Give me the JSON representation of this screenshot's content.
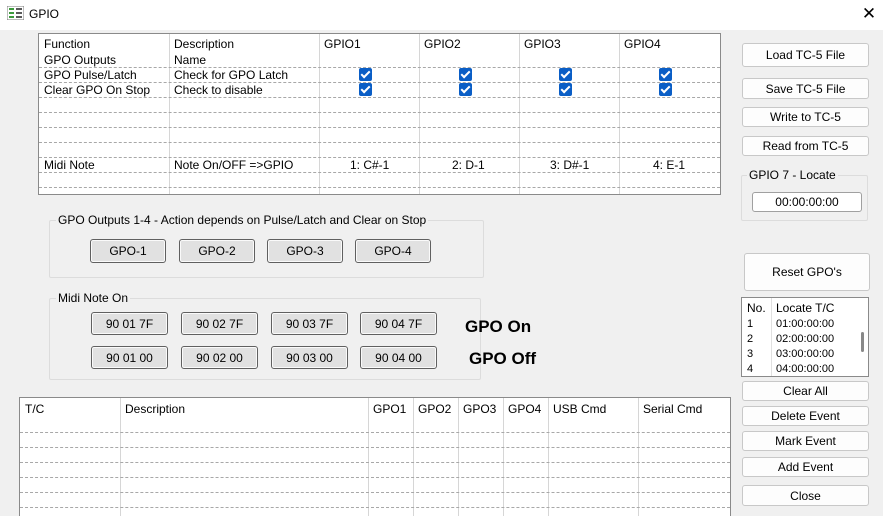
{
  "window": {
    "title": "GPIO",
    "close_glyph": "✕",
    "icon": "gpio-app-icon"
  },
  "gpio_grid": {
    "headers": [
      "Function",
      "Description",
      "GPIO1",
      "GPIO2",
      "GPIO3",
      "GPIO4"
    ],
    "rows": [
      {
        "function": "GPO Outputs",
        "description": "Name",
        "checks": [
          false,
          false,
          false,
          false
        ]
      },
      {
        "function": "GPO Pulse/Latch",
        "description": "Check for GPO Latch",
        "checks": [
          true,
          true,
          true,
          true
        ]
      },
      {
        "function": "Clear GPO On Stop",
        "description": "Check to disable",
        "checks": [
          true,
          true,
          true,
          true
        ]
      }
    ],
    "midi_row": {
      "function": "Midi Note",
      "description": "Note On/OFF =>GPIO",
      "notes": [
        "1: C#-1",
        "2: D-1",
        "3: D#-1",
        "4: E-1"
      ]
    }
  },
  "gpo_outputs_group": {
    "label": "GPO Outputs 1-4 - Action depends on Pulse/Latch and Clear on Stop",
    "buttons": [
      "GPO-1",
      "GPO-2",
      "GPO-3",
      "GPO-4"
    ]
  },
  "midi_group": {
    "label": "Midi Note On",
    "on_buttons": [
      "90 01 7F",
      "90 02 7F",
      "90 03 7F",
      "90 04 7F"
    ],
    "off_buttons": [
      "90 01 00",
      "90 02 00",
      "90 03 00",
      "90 04 00"
    ],
    "on_label": "GPO On",
    "off_label": "GPO Off"
  },
  "event_grid": {
    "headers": [
      "T/C",
      "Description",
      "GPO1",
      "GPO2",
      "GPO3",
      "GPO4",
      "USB Cmd",
      "Serial Cmd"
    ]
  },
  "right_panel": {
    "load": "Load TC-5 File",
    "save": "Save TC-5 File",
    "write": "Write to TC-5",
    "read": "Read from TC-5",
    "locate_group_label": "GPIO 7 - Locate",
    "locate_value": "00:00:00:00",
    "reset": "Reset GPO's",
    "locate_list": {
      "headers": [
        "No.",
        "Locate T/C"
      ],
      "rows": [
        {
          "no": "1",
          "tc": "01:00:00:00"
        },
        {
          "no": "2",
          "tc": "02:00:00:00"
        },
        {
          "no": "3",
          "tc": "03:00:00:00"
        },
        {
          "no": "4",
          "tc": "04:00:00:00"
        }
      ]
    },
    "clear_all": "Clear All",
    "delete_event": "Delete Event",
    "mark_event": "Mark Event",
    "add_event": "Add Event",
    "close": "Close"
  }
}
